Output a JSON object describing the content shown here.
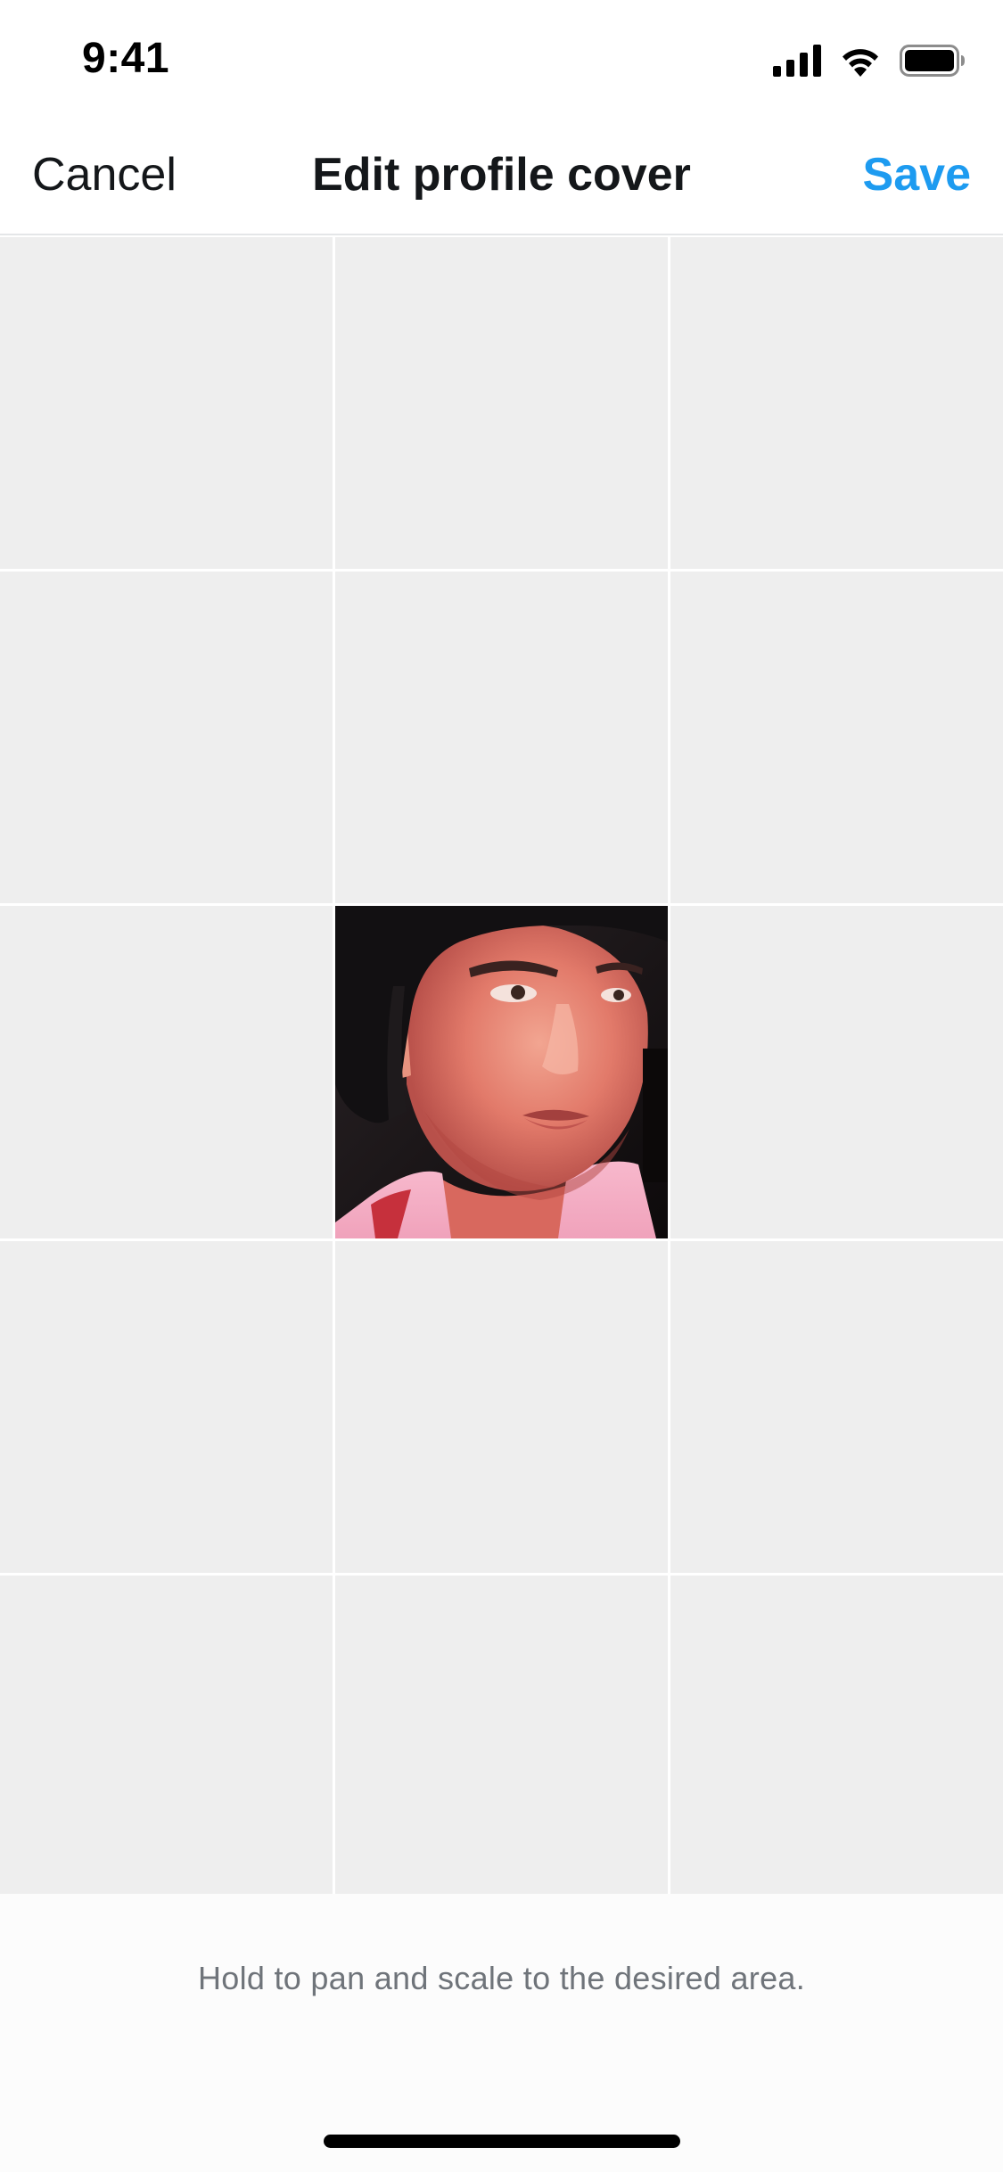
{
  "status_bar": {
    "time": "9:41",
    "icons": [
      "cellular-signal-icon",
      "wifi-icon",
      "battery-icon"
    ]
  },
  "nav": {
    "cancel_label": "Cancel",
    "title": "Edit profile cover",
    "save_label": "Save"
  },
  "crop_grid": {
    "columns": 3,
    "rows": 5,
    "photo_cell": {
      "row": 3,
      "column": 2,
      "content": "profile-photo-image"
    }
  },
  "hint": {
    "text": "Hold to pan and scale to the desired area."
  },
  "colors": {
    "accent": "#1d9bf0",
    "text_primary": "#14171a",
    "hint_text": "#6f747a",
    "grid_cell": "#eeeeee"
  }
}
